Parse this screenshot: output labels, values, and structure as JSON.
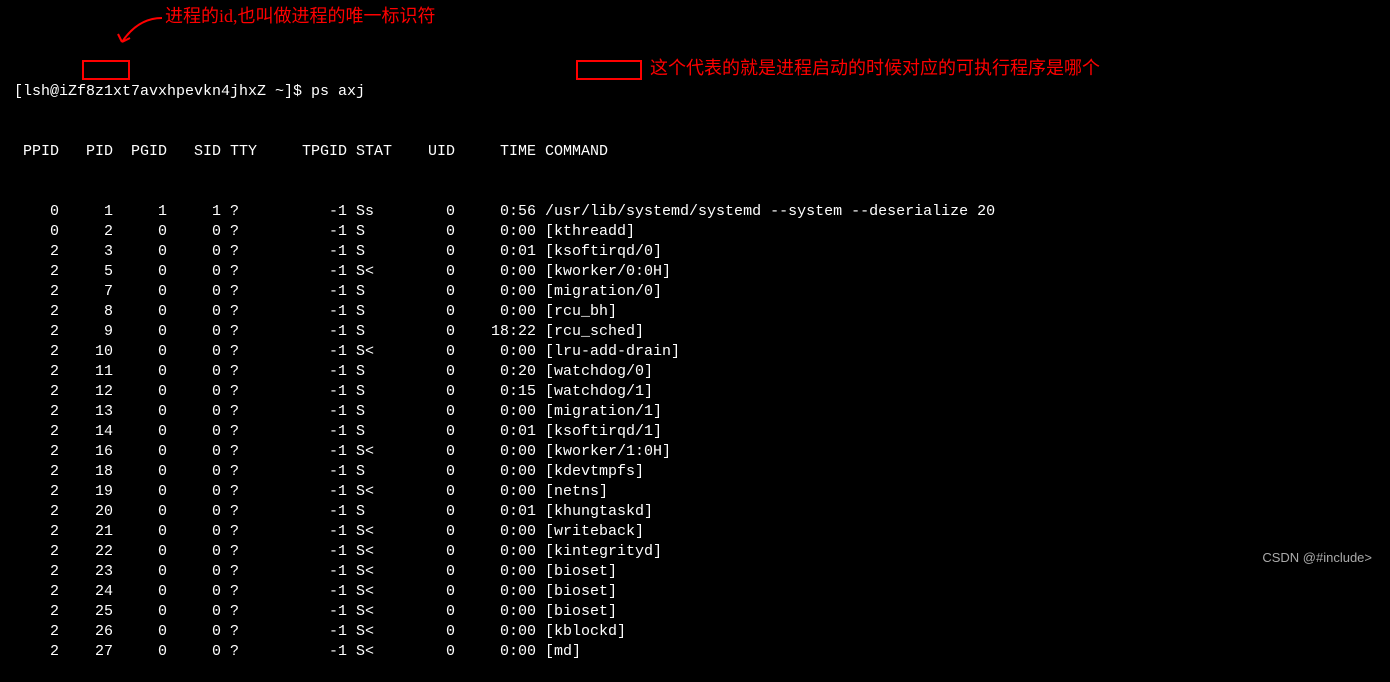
{
  "annotations": {
    "pid_note": "进程的id,也叫做进程的唯一标识符",
    "command_note": "这个代表的就是进程启动的时候对应的可执行程序是哪个"
  },
  "prompt": "[lsh@iZf8z1xt7avxhpevkn4jhxZ ~]$ ps axj",
  "headers": {
    "ppid": "PPID",
    "pid": "PID",
    "pgid": "PGID",
    "sid": "SID",
    "tty": "TTY",
    "tpgid": "TPGID",
    "stat": "STAT",
    "uid": "UID",
    "time": "TIME",
    "command": "COMMAND"
  },
  "rows": [
    {
      "ppid": "0",
      "pid": "1",
      "pgid": "1",
      "sid": "1",
      "tty": "?",
      "tpgid": "-1",
      "stat": "Ss",
      "uid": "0",
      "time": "0:56",
      "cmd": "/usr/lib/systemd/systemd --system --deserialize 20"
    },
    {
      "ppid": "0",
      "pid": "2",
      "pgid": "0",
      "sid": "0",
      "tty": "?",
      "tpgid": "-1",
      "stat": "S",
      "uid": "0",
      "time": "0:00",
      "cmd": "[kthreadd]"
    },
    {
      "ppid": "2",
      "pid": "3",
      "pgid": "0",
      "sid": "0",
      "tty": "?",
      "tpgid": "-1",
      "stat": "S",
      "uid": "0",
      "time": "0:01",
      "cmd": "[ksoftirqd/0]"
    },
    {
      "ppid": "2",
      "pid": "5",
      "pgid": "0",
      "sid": "0",
      "tty": "?",
      "tpgid": "-1",
      "stat": "S<",
      "uid": "0",
      "time": "0:00",
      "cmd": "[kworker/0:0H]"
    },
    {
      "ppid": "2",
      "pid": "7",
      "pgid": "0",
      "sid": "0",
      "tty": "?",
      "tpgid": "-1",
      "stat": "S",
      "uid": "0",
      "time": "0:00",
      "cmd": "[migration/0]"
    },
    {
      "ppid": "2",
      "pid": "8",
      "pgid": "0",
      "sid": "0",
      "tty": "?",
      "tpgid": "-1",
      "stat": "S",
      "uid": "0",
      "time": "0:00",
      "cmd": "[rcu_bh]"
    },
    {
      "ppid": "2",
      "pid": "9",
      "pgid": "0",
      "sid": "0",
      "tty": "?",
      "tpgid": "-1",
      "stat": "S",
      "uid": "0",
      "time": "18:22",
      "cmd": "[rcu_sched]"
    },
    {
      "ppid": "2",
      "pid": "10",
      "pgid": "0",
      "sid": "0",
      "tty": "?",
      "tpgid": "-1",
      "stat": "S<",
      "uid": "0",
      "time": "0:00",
      "cmd": "[lru-add-drain]"
    },
    {
      "ppid": "2",
      "pid": "11",
      "pgid": "0",
      "sid": "0",
      "tty": "?",
      "tpgid": "-1",
      "stat": "S",
      "uid": "0",
      "time": "0:20",
      "cmd": "[watchdog/0]"
    },
    {
      "ppid": "2",
      "pid": "12",
      "pgid": "0",
      "sid": "0",
      "tty": "?",
      "tpgid": "-1",
      "stat": "S",
      "uid": "0",
      "time": "0:15",
      "cmd": "[watchdog/1]"
    },
    {
      "ppid": "2",
      "pid": "13",
      "pgid": "0",
      "sid": "0",
      "tty": "?",
      "tpgid": "-1",
      "stat": "S",
      "uid": "0",
      "time": "0:00",
      "cmd": "[migration/1]"
    },
    {
      "ppid": "2",
      "pid": "14",
      "pgid": "0",
      "sid": "0",
      "tty": "?",
      "tpgid": "-1",
      "stat": "S",
      "uid": "0",
      "time": "0:01",
      "cmd": "[ksoftirqd/1]"
    },
    {
      "ppid": "2",
      "pid": "16",
      "pgid": "0",
      "sid": "0",
      "tty": "?",
      "tpgid": "-1",
      "stat": "S<",
      "uid": "0",
      "time": "0:00",
      "cmd": "[kworker/1:0H]"
    },
    {
      "ppid": "2",
      "pid": "18",
      "pgid": "0",
      "sid": "0",
      "tty": "?",
      "tpgid": "-1",
      "stat": "S",
      "uid": "0",
      "time": "0:00",
      "cmd": "[kdevtmpfs]"
    },
    {
      "ppid": "2",
      "pid": "19",
      "pgid": "0",
      "sid": "0",
      "tty": "?",
      "tpgid": "-1",
      "stat": "S<",
      "uid": "0",
      "time": "0:00",
      "cmd": "[netns]"
    },
    {
      "ppid": "2",
      "pid": "20",
      "pgid": "0",
      "sid": "0",
      "tty": "?",
      "tpgid": "-1",
      "stat": "S",
      "uid": "0",
      "time": "0:01",
      "cmd": "[khungtaskd]"
    },
    {
      "ppid": "2",
      "pid": "21",
      "pgid": "0",
      "sid": "0",
      "tty": "?",
      "tpgid": "-1",
      "stat": "S<",
      "uid": "0",
      "time": "0:00",
      "cmd": "[writeback]"
    },
    {
      "ppid": "2",
      "pid": "22",
      "pgid": "0",
      "sid": "0",
      "tty": "?",
      "tpgid": "-1",
      "stat": "S<",
      "uid": "0",
      "time": "0:00",
      "cmd": "[kintegrityd]"
    },
    {
      "ppid": "2",
      "pid": "23",
      "pgid": "0",
      "sid": "0",
      "tty": "?",
      "tpgid": "-1",
      "stat": "S<",
      "uid": "0",
      "time": "0:00",
      "cmd": "[bioset]"
    },
    {
      "ppid": "2",
      "pid": "24",
      "pgid": "0",
      "sid": "0",
      "tty": "?",
      "tpgid": "-1",
      "stat": "S<",
      "uid": "0",
      "time": "0:00",
      "cmd": "[bioset]"
    },
    {
      "ppid": "2",
      "pid": "25",
      "pgid": "0",
      "sid": "0",
      "tty": "?",
      "tpgid": "-1",
      "stat": "S<",
      "uid": "0",
      "time": "0:00",
      "cmd": "[bioset]"
    },
    {
      "ppid": "2",
      "pid": "26",
      "pgid": "0",
      "sid": "0",
      "tty": "?",
      "tpgid": "-1",
      "stat": "S<",
      "uid": "0",
      "time": "0:00",
      "cmd": "[kblockd]"
    },
    {
      "ppid": "2",
      "pid": "27",
      "pgid": "0",
      "sid": "0",
      "tty": "?",
      "tpgid": "-1",
      "stat": "S<",
      "uid": "0",
      "time": "0:00",
      "cmd": "[md]"
    }
  ],
  "watermark": "CSDN @#include>"
}
